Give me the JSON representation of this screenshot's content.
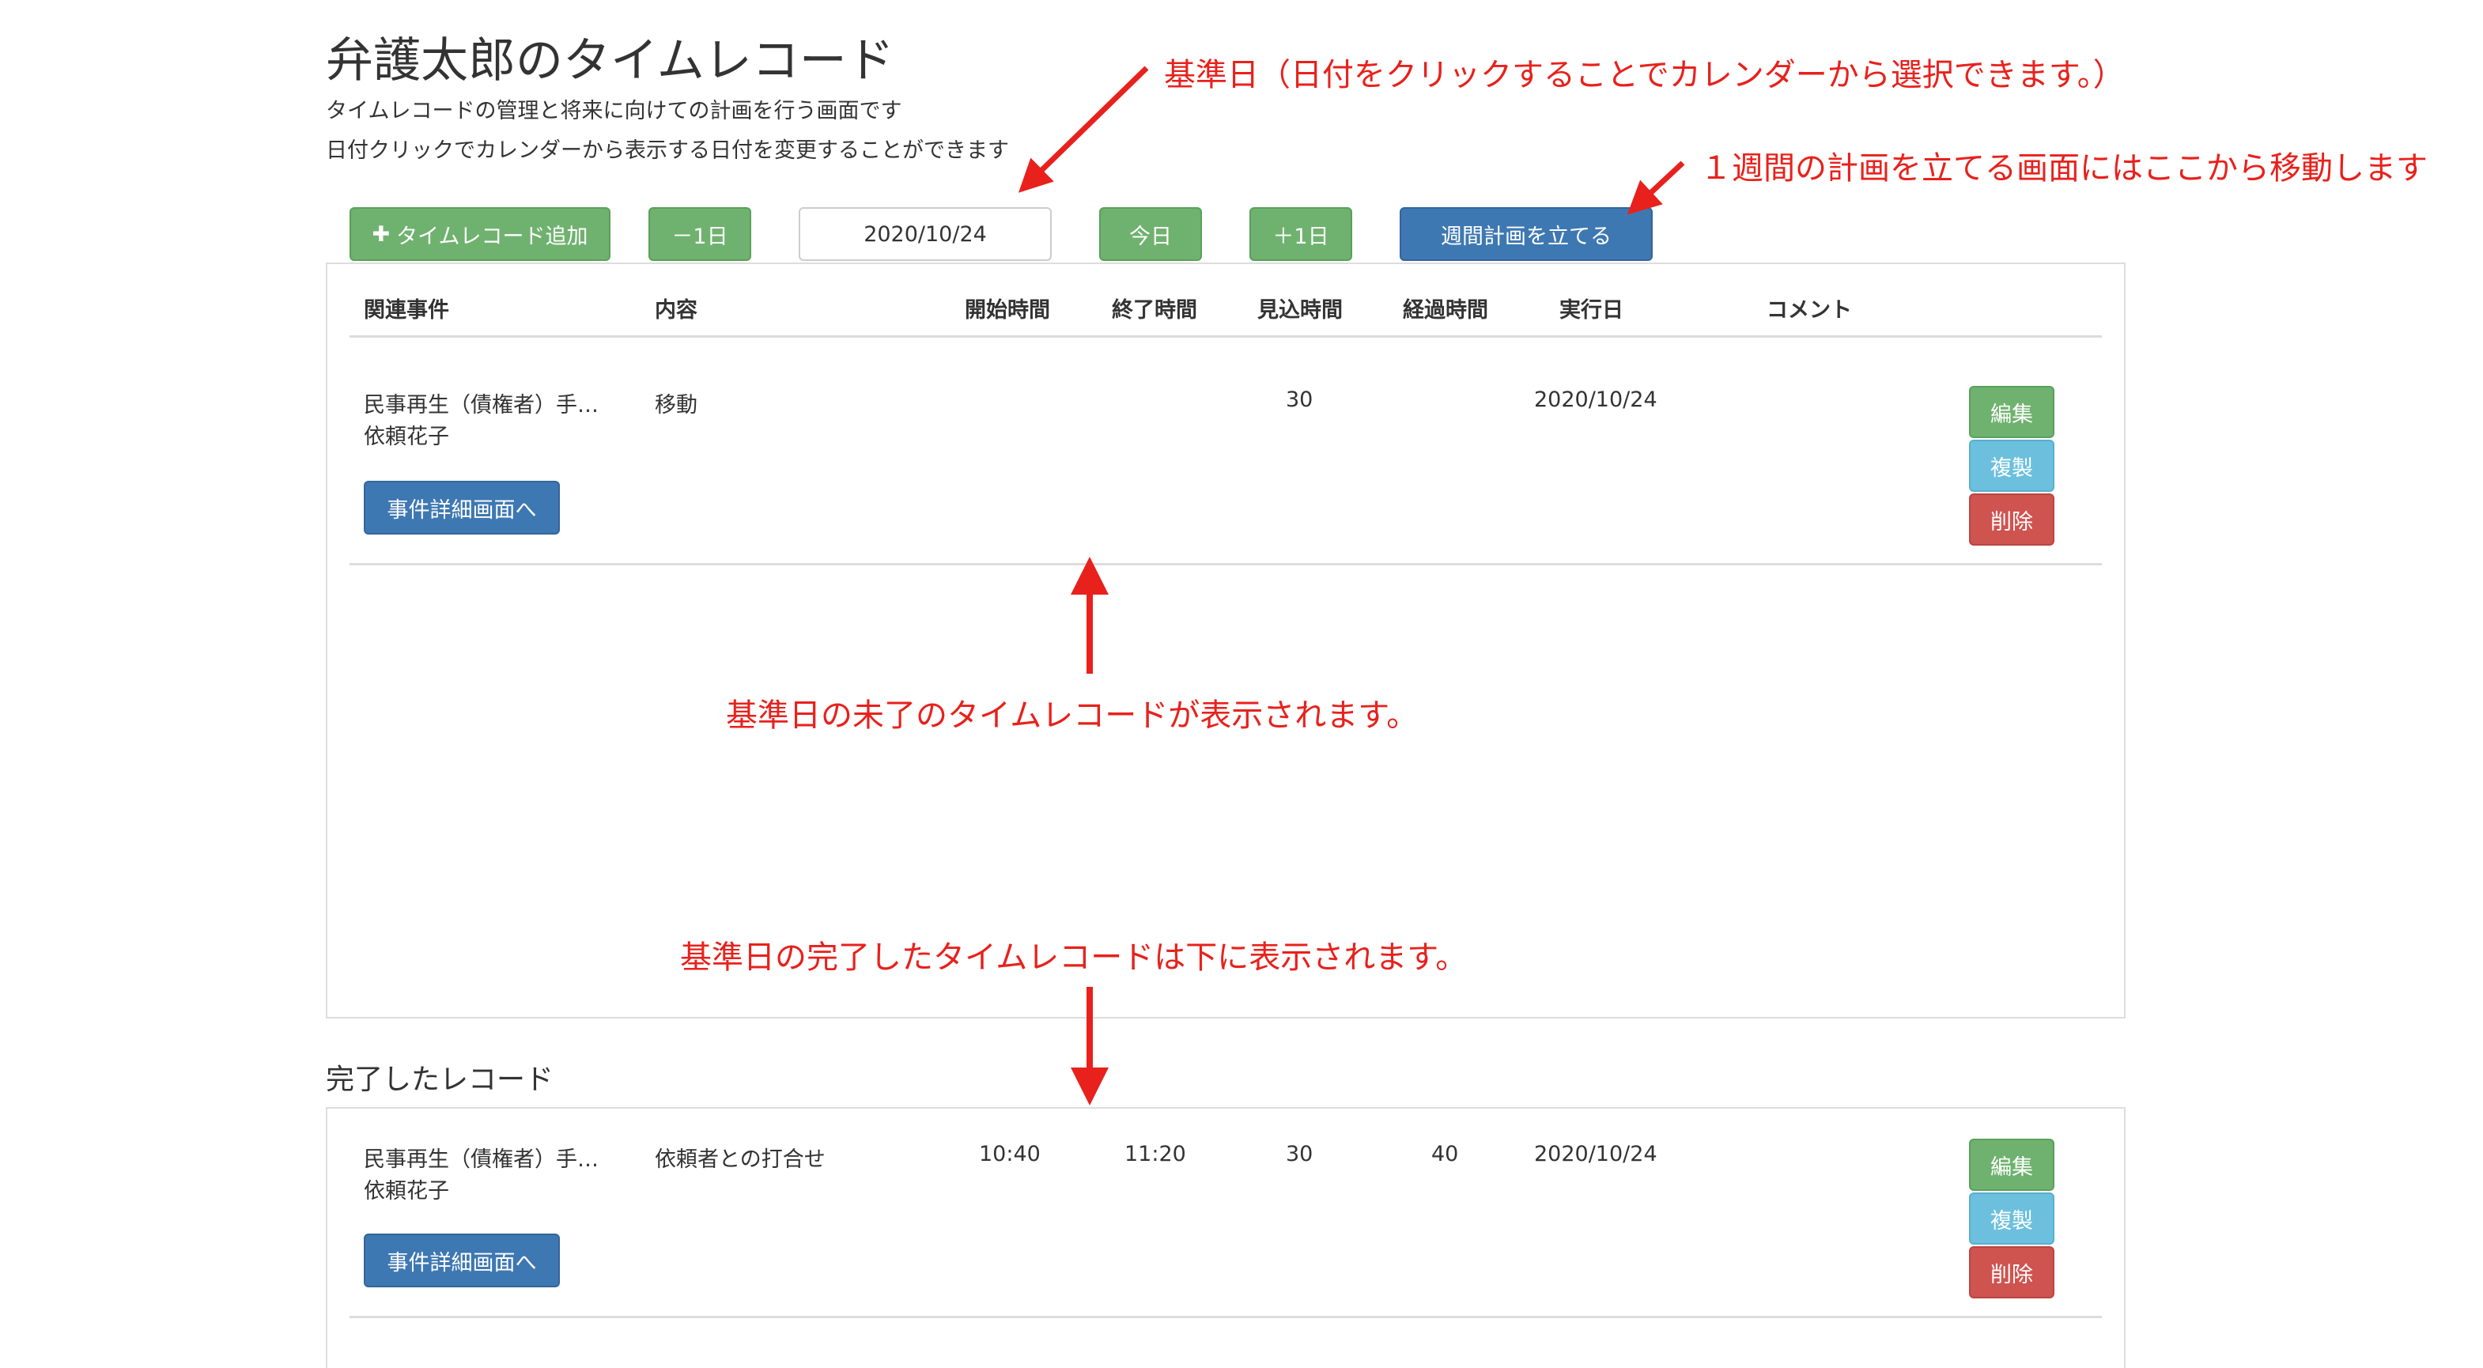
{
  "header": {
    "title": "弁護太郎のタイムレコード",
    "subtitle1": "タイムレコードの管理と将来に向けての計画を行う画面です",
    "subtitle2": "日付クリックでカレンダーから表示する日付を変更することができます"
  },
  "toolbar": {
    "add_icon": "✚",
    "add_label": "タイムレコード追加",
    "prev_day_label": "－1日",
    "date_value": "2020/10/24",
    "today_label": "今日",
    "next_day_label": "＋1日",
    "weekly_plan_label": "週間計画を立てる"
  },
  "table": {
    "columns": [
      "関連事件",
      "内容",
      "開始時間",
      "終了時間",
      "見込時間",
      "経過時間",
      "実行日",
      "コメント"
    ]
  },
  "pending_records": [
    {
      "case": "民事再生（債権者）手…",
      "client": "依頼花子",
      "content": "移動",
      "start": "",
      "end": "",
      "estimated": "30",
      "elapsed": "",
      "date": "2020/10/24",
      "comment": "",
      "detail_button": "事件詳細画面へ",
      "edit_button": "編集",
      "copy_button": "複製",
      "delete_button": "削除"
    }
  ],
  "completed_heading": "完了したレコード",
  "completed_records": [
    {
      "case": "民事再生（債権者）手…",
      "client": "依頼花子",
      "content": "依頼者との打合せ",
      "start": "10:40",
      "end": "11:20",
      "estimated": "30",
      "elapsed": "40",
      "date": "2020/10/24",
      "comment": "",
      "detail_button": "事件詳細画面へ",
      "edit_button": "編集",
      "copy_button": "複製",
      "delete_button": "削除"
    }
  ],
  "annotations": {
    "base_date": "基準日（日付をクリックすることでカレンダーから選択できます。）",
    "weekly": "１週間の計画を立てる画面にはここから移動します",
    "pending": "基準日の未了のタイムレコードが表示されます。",
    "completed": "基準日の完了したタイムレコードは下に表示されます。"
  },
  "colors": {
    "green_button": "#6fb26f",
    "blue_button": "#3e78b2",
    "cyan_button": "#6cc0dd",
    "red_button": "#cf534f",
    "annotation_red": "#e8211c"
  }
}
